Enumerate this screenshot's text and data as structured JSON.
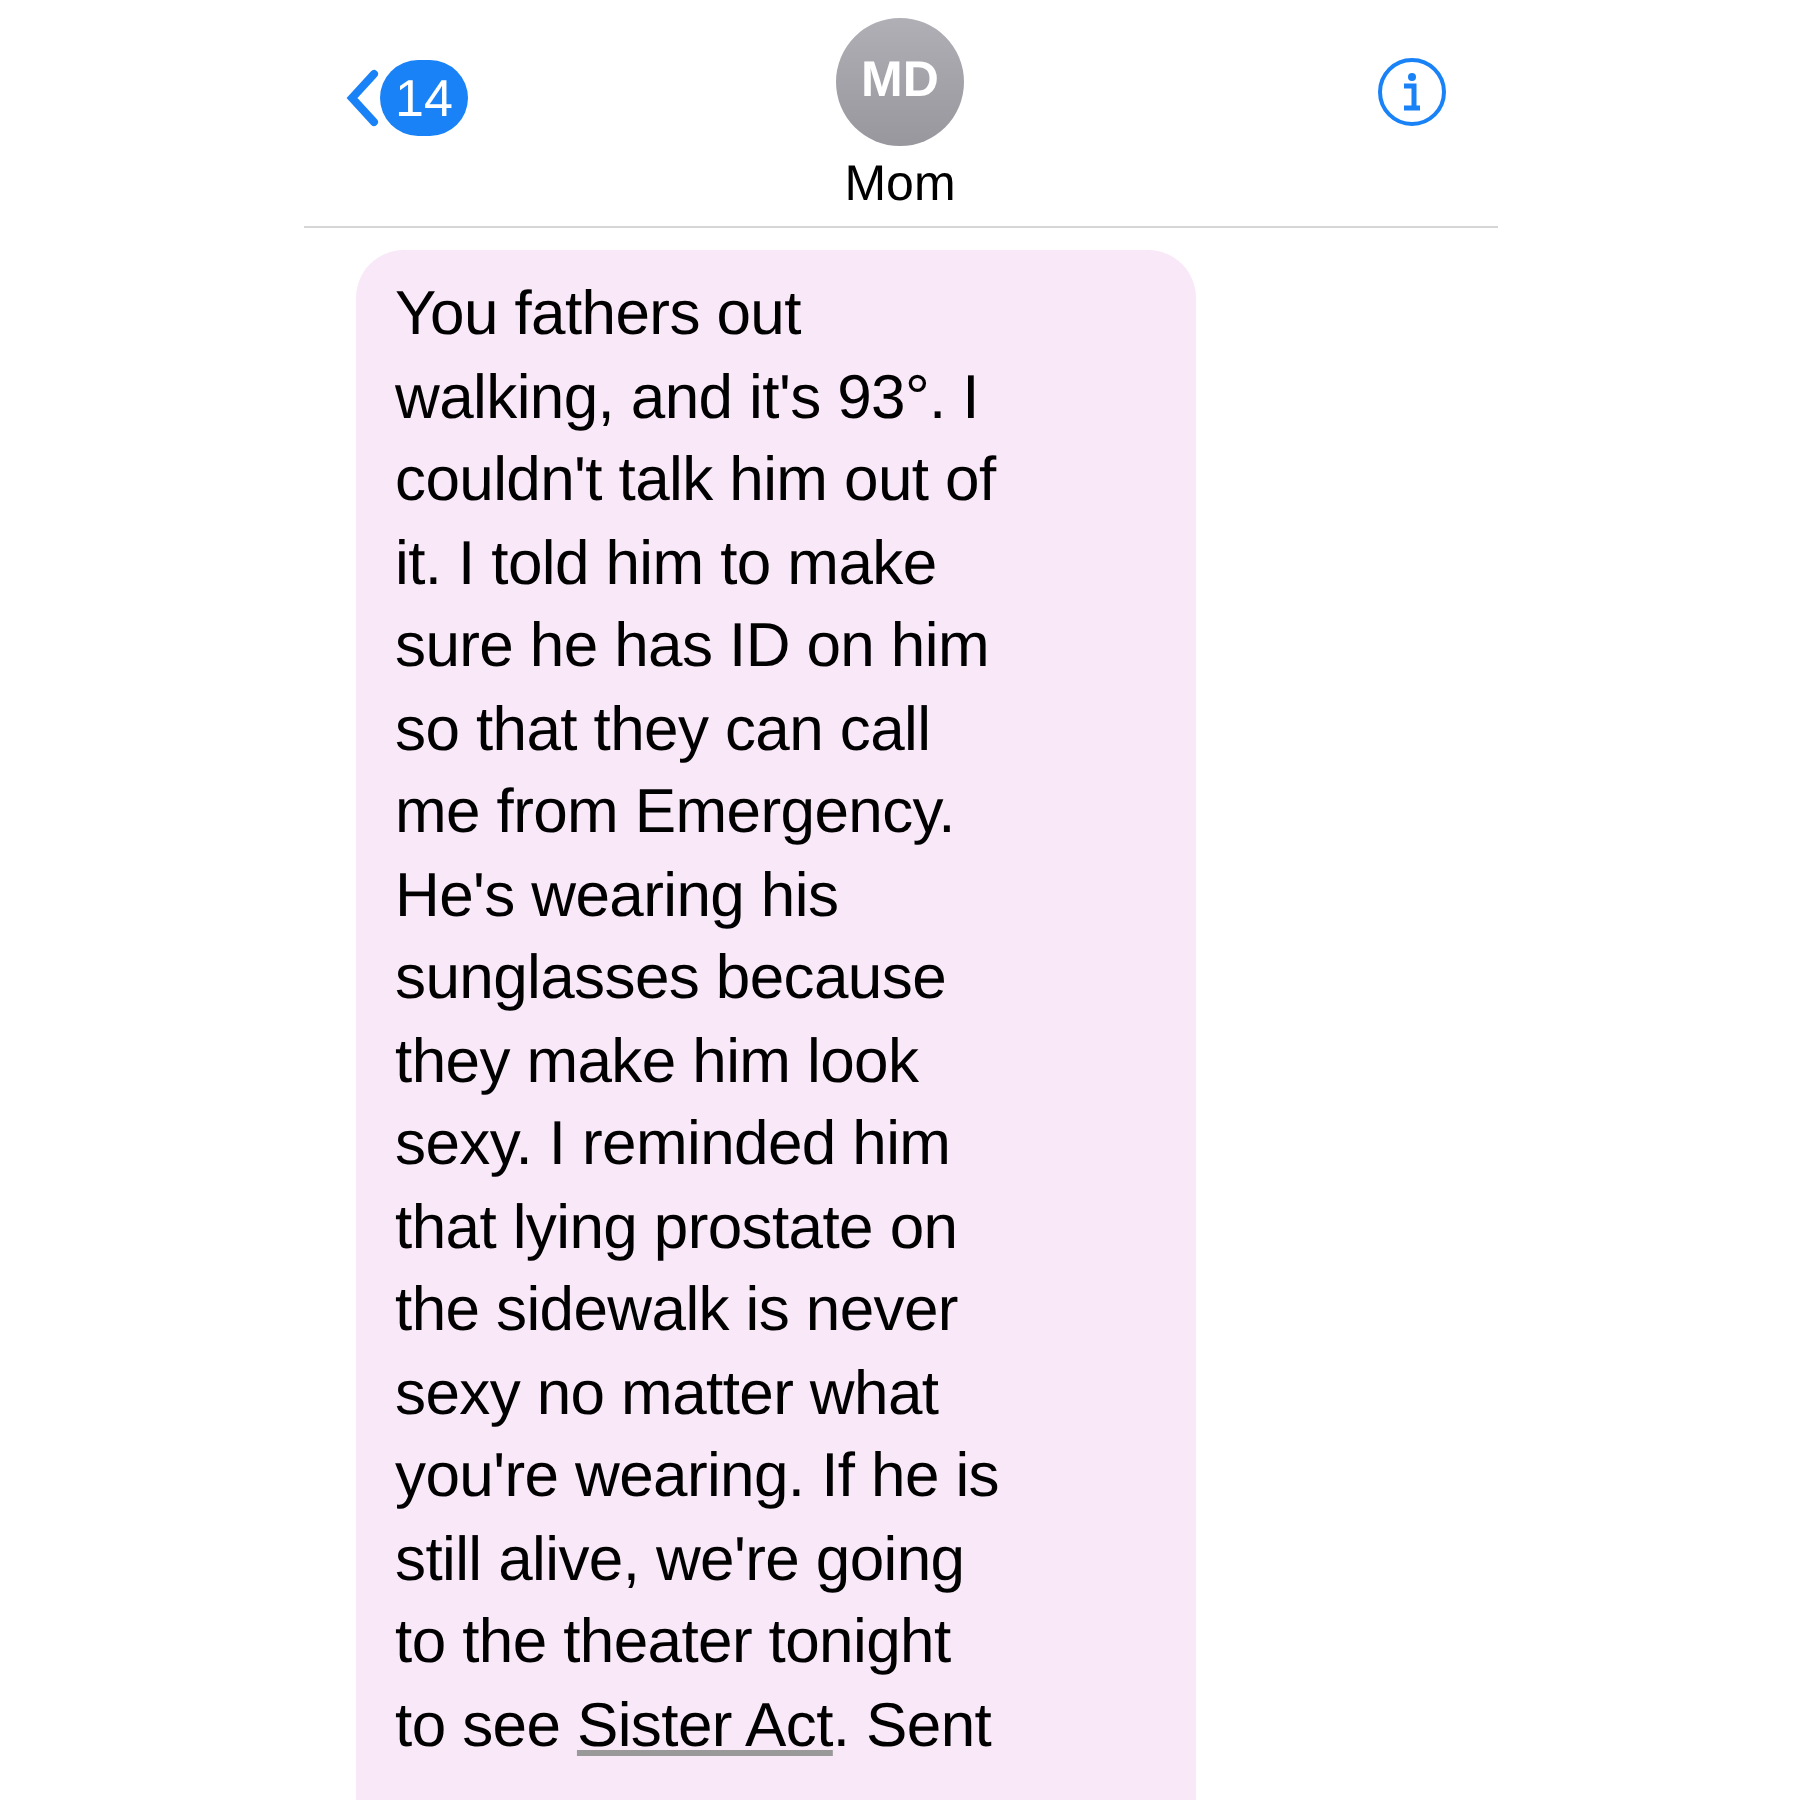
{
  "header": {
    "back_count": "14",
    "avatar_initials": "MD",
    "contact_name": "Mom"
  },
  "message": {
    "lines": [
      [
        {
          "kind": "text",
          "text": "You fathers out"
        }
      ],
      [
        {
          "kind": "text",
          "text": "walking, and it's 93°. I"
        }
      ],
      [
        {
          "kind": "text",
          "text": "couldn't talk him out of"
        }
      ],
      [
        {
          "kind": "text",
          "text": "it. I told him to make"
        }
      ],
      [
        {
          "kind": "text",
          "text": "sure he has ID on him"
        }
      ],
      [
        {
          "kind": "text",
          "text": "so that they can call"
        }
      ],
      [
        {
          "kind": "text",
          "text": "me from Emergency."
        }
      ],
      [
        {
          "kind": "text",
          "text": "He's wearing his"
        }
      ],
      [
        {
          "kind": "text",
          "text": "sunglasses because"
        }
      ],
      [
        {
          "kind": "text",
          "text": "they make him look"
        }
      ],
      [
        {
          "kind": "text",
          "text": "sexy. I reminded him"
        }
      ],
      [
        {
          "kind": "text",
          "text": "that lying prostate on"
        }
      ],
      [
        {
          "kind": "text",
          "text": "the sidewalk is never"
        }
      ],
      [
        {
          "kind": "text",
          "text": "sexy no matter what"
        }
      ],
      [
        {
          "kind": "text",
          "text": "you're wearing. If he is"
        }
      ],
      [
        {
          "kind": "text",
          "text": "still alive, we're going"
        }
      ],
      [
        {
          "kind": "text",
          "text": "to the theater tonight"
        }
      ],
      [
        {
          "kind": "text",
          "text": "to see "
        },
        {
          "kind": "link",
          "text": "Sister Act"
        },
        {
          "kind": "text",
          "text": ". Sent"
        }
      ]
    ]
  }
}
